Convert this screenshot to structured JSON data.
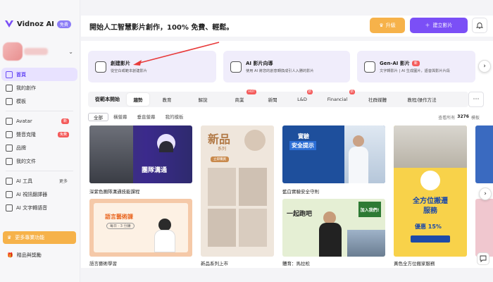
{
  "brand": {
    "name": "Vidnoz AI",
    "badge": "免費"
  },
  "sidebar": {
    "items": [
      {
        "label": "首頁",
        "icon": "home-icon",
        "active": true
      },
      {
        "label": "我的創作",
        "icon": "play-icon"
      },
      {
        "label": "模板",
        "icon": "template-icon"
      }
    ],
    "items2": [
      {
        "label": "Avatar",
        "icon": "avatar-icon",
        "tag": "新"
      },
      {
        "label": "聲音克隆",
        "icon": "voice-icon",
        "tag": "免費"
      },
      {
        "label": "品牌",
        "icon": "brand-icon"
      },
      {
        "label": "我的文件",
        "icon": "folder-icon"
      }
    ],
    "ai_tools": {
      "label": "AI 工具",
      "more": "更多"
    },
    "items3": [
      {
        "label": "AI 視訊翻譯器",
        "icon": "translate-icon"
      },
      {
        "label": "AI 文字轉語音",
        "icon": "tts-icon"
      }
    ],
    "pro_button": "更多專業功能",
    "gift": "贈品與獎勵"
  },
  "header": {
    "headline": "開始人工智慧影片創作，100% 免費、輕鬆。",
    "upgrade": "升級",
    "create": "建立影片"
  },
  "features": [
    {
      "title": "創建影片",
      "sub": "從空白或範本創建影片",
      "icon": "create-video-icon"
    },
    {
      "title": "AI 影片向導",
      "sub": "使用 AI 將您的創意轉換成引人入勝的影片",
      "icon": "ai-wizard-icon"
    },
    {
      "title": "Gen-AI 影片",
      "tag": "新",
      "sub": "文字轉影片 | AI 生成圖片，語音與影片片段",
      "icon": "gen-ai-icon"
    }
  ],
  "categories": {
    "label": "從範本開始",
    "tabs": [
      {
        "label": "趨勢",
        "active": true
      },
      {
        "label": "教育"
      },
      {
        "label": "解說"
      },
      {
        "label": "商業",
        "tag": "HOT"
      },
      {
        "label": "新聞"
      },
      {
        "label": "L&D",
        "tag": "新"
      },
      {
        "label": "Financial",
        "tag": "新"
      },
      {
        "label": "社群媒體"
      },
      {
        "label": "教程/操作方法"
      }
    ]
  },
  "filters": {
    "chips": [
      "全部",
      "橫螢幕",
      "垂直螢幕",
      "我的模板"
    ],
    "view_all": "查看所有",
    "count": "3276",
    "unit": "模板"
  },
  "templates": [
    {
      "caption": "深紫色團隊溝通技能課程",
      "overlay": "團隊溝通"
    },
    {
      "caption": "語言藝術學習",
      "overlay": "語言藝術課",
      "pill": "每日 · 3 分鐘"
    },
    {
      "caption": "新品系列上市",
      "overlay": "新品",
      "overlay2": "系列",
      "pill": "立即購買"
    },
    {
      "caption": "藍白實驗安全守則",
      "overlay": "實驗",
      "overlay2": "安全提示"
    },
    {
      "caption": "體育：馬拉松",
      "overlay": "一起跑吧",
      "overlay2": "加入我們!"
    },
    {
      "caption": "黃色全方位搬家服務",
      "overlay": "全方位搬遷",
      "overlay2": "服務",
      "overlay3": "優惠 15%"
    }
  ],
  "colors": {
    "accent": "#7b4ff6",
    "gold": "#f6b24a",
    "hot": "#f45b5b",
    "active_bg": "#e8e2ff"
  }
}
